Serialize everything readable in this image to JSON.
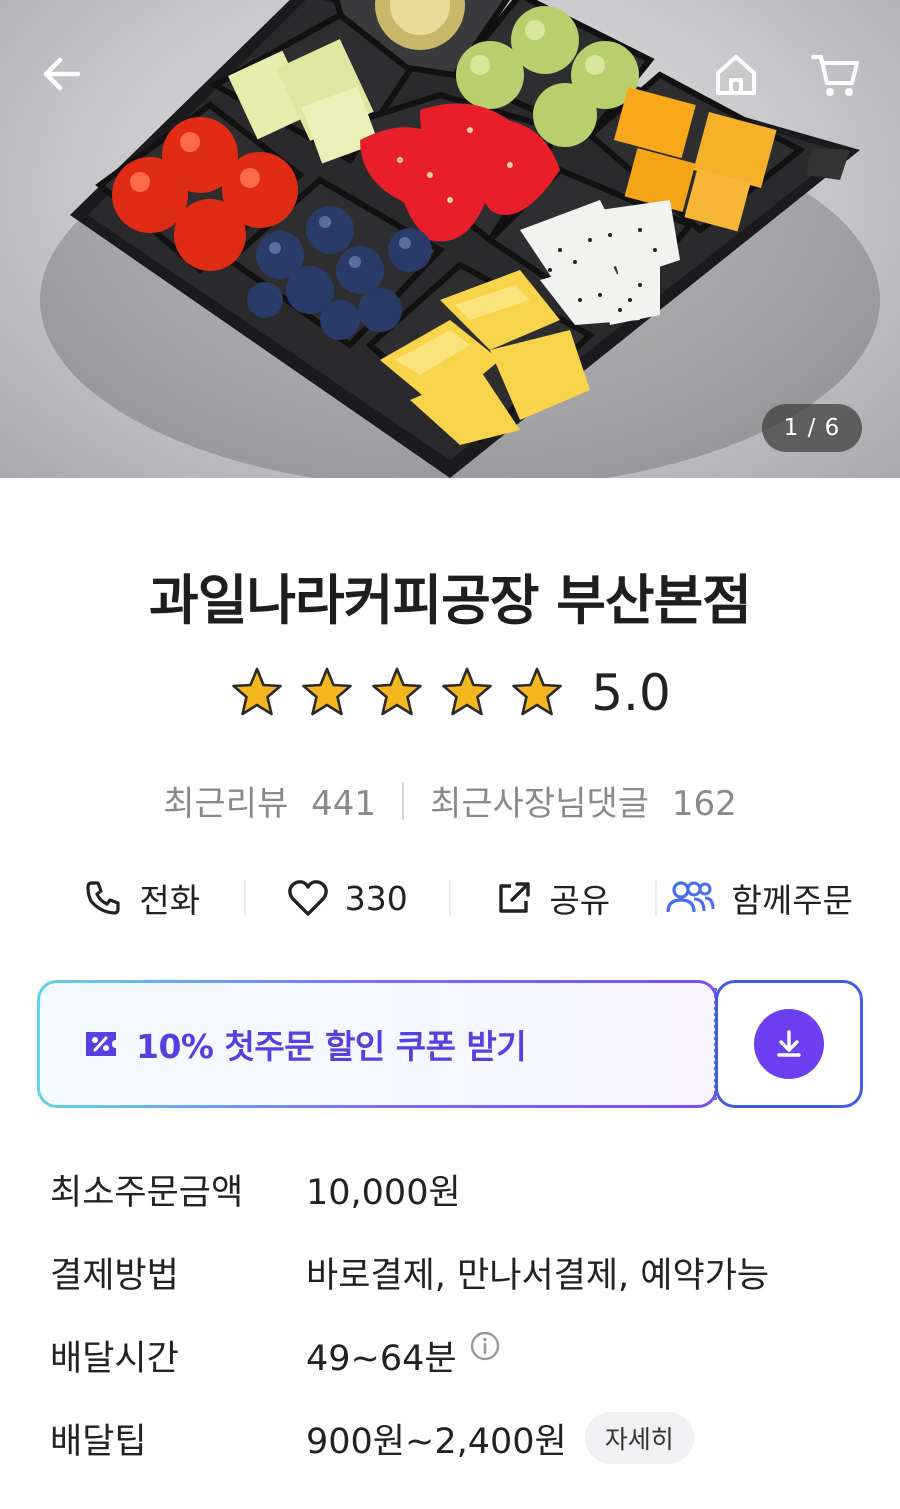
{
  "hero": {
    "image_alt": "fruit box",
    "counter": "1 / 6",
    "icons": {
      "back": "arrow-left-icon",
      "home": "home-icon",
      "cart": "cart-icon"
    }
  },
  "store": {
    "name": "과일나라커피공장 부산본점",
    "rating": "5.0",
    "rating_stars": 5,
    "reviews_label": "최근리뷰",
    "reviews_count": "441",
    "owner_replies_label": "최근사장님댓글",
    "owner_replies_count": "162"
  },
  "actions": [
    {
      "label": "전화",
      "icon": "phone-icon"
    },
    {
      "label": "330",
      "icon": "heart-icon"
    },
    {
      "label": "공유",
      "icon": "share-icon"
    },
    {
      "label": "함께주문",
      "icon": "group-icon"
    }
  ],
  "coupon": {
    "text": "10% 첫주문 할인 쿠폰 받기",
    "icon": "coupon-icon",
    "download_icon": "download-icon"
  },
  "info": {
    "min_order": {
      "label": "최소주문금액",
      "value": "10,000원"
    },
    "payment": {
      "label": "결제방법",
      "value": "바로결제, 만나서결제, 예약가능"
    },
    "delivery_time": {
      "label": "배달시간",
      "value": "49~64분"
    },
    "delivery_tip": {
      "label": "배달팁",
      "value": "900원~2,400원",
      "detail_label": "자세히"
    }
  },
  "colors": {
    "accent_purple": "#6c3ff0",
    "coupon_text": "#5a3fe0",
    "star_gold": "#f4b81e",
    "gray_text": "#8a8a8a"
  }
}
